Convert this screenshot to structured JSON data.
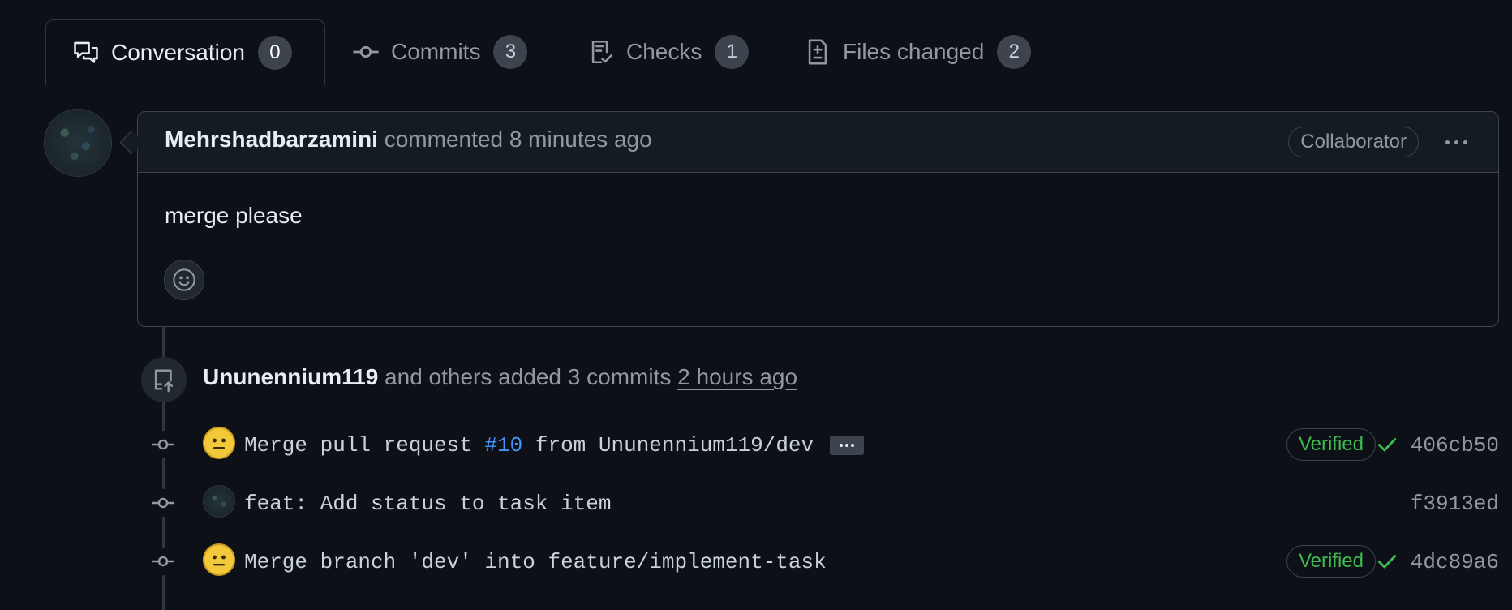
{
  "tabs": [
    {
      "label": "Conversation",
      "count": "0",
      "icon": "comment-discussion-icon",
      "active": true
    },
    {
      "label": "Commits",
      "count": "3",
      "icon": "git-commit-icon",
      "active": false
    },
    {
      "label": "Checks",
      "count": "1",
      "icon": "checklist-icon",
      "active": false
    },
    {
      "label": "Files changed",
      "count": "2",
      "icon": "file-diff-icon",
      "active": false
    }
  ],
  "comment": {
    "author": "Mehrshadbarzamini",
    "action": "commented",
    "time": "8 minutes ago",
    "role": "Collaborator",
    "body": "merge please"
  },
  "push_event": {
    "author": "Ununennium119",
    "text": "and others added 3 commits",
    "time": "2 hours ago"
  },
  "commits": [
    {
      "prefix": "Merge pull request ",
      "link": "#10",
      "suffix": " from Ununennium119/dev",
      "verified": "Verified",
      "sha": "406cb50"
    },
    {
      "message": "feat: Add status to task item",
      "sha": "f3913ed"
    },
    {
      "message": "Merge branch 'dev' into feature/implement-task",
      "verified": "Verified",
      "sha": "4dc89a6"
    }
  ],
  "colors": {
    "background": "#0d1117",
    "link": "#4493f8",
    "success": "#3fb950",
    "muted": "#9198a1"
  }
}
